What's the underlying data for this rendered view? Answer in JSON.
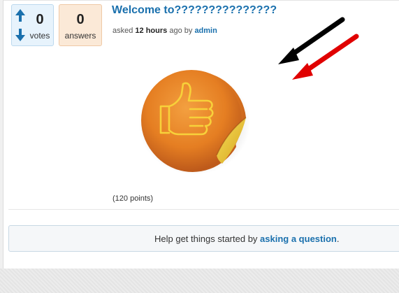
{
  "question": {
    "votes_count": "0",
    "votes_label": "votes",
    "answers_count": "0",
    "answers_label": "answers",
    "title": "Welcome to???????????????",
    "meta_prefix": "asked",
    "meta_time": "12 hours",
    "meta_middle": "ago by",
    "meta_author": "admin",
    "points": "(120 points)"
  },
  "notice": {
    "prefix": "Help get things started by",
    "link": "asking a question",
    "suffix": "."
  },
  "colors": {
    "link": "#1a70ad",
    "vote_arrow": "#1a70ad",
    "annotation_arrow_black": "#000000",
    "annotation_arrow_red": "#e00000"
  },
  "icons": {
    "vote_up": "arrow-up-icon",
    "vote_down": "arrow-down-icon",
    "sticker": "thumbs-up-sticker-icon"
  }
}
